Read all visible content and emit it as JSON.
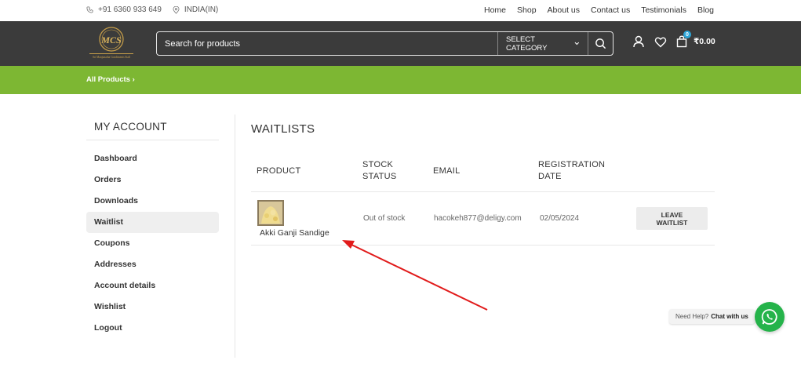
{
  "topbar": {
    "phone": "+91 6360 933 649",
    "location": "INDIA(IN)",
    "nav": [
      "Home",
      "Shop",
      "About us",
      "Contact us",
      "Testimonials",
      "Blog"
    ]
  },
  "header": {
    "logo_text": "MCS",
    "logo_tagline": "Sri Manjunatha Condiments Stall",
    "search_placeholder": "Search for products",
    "category_label": "SELECT CATEGORY",
    "cart_count": "0",
    "cart_total": "₹0.00"
  },
  "breadcrumb": {
    "label": "All Products"
  },
  "sidebar": {
    "title": "MY ACCOUNT",
    "items": [
      {
        "label": "Dashboard",
        "active": false
      },
      {
        "label": "Orders",
        "active": false
      },
      {
        "label": "Downloads",
        "active": false
      },
      {
        "label": "Waitlist",
        "active": true
      },
      {
        "label": "Coupons",
        "active": false
      },
      {
        "label": "Addresses",
        "active": false
      },
      {
        "label": "Account details",
        "active": false
      },
      {
        "label": "Wishlist",
        "active": false
      },
      {
        "label": "Logout",
        "active": false
      }
    ]
  },
  "main": {
    "heading": "WAITLISTS",
    "columns": {
      "product": "PRODUCT",
      "stock_line1": "STOCK",
      "stock_line2": "STATUS",
      "email": "EMAIL",
      "reg_line1": "REGISTRATION",
      "reg_line2": "DATE"
    },
    "rows": [
      {
        "product": "Akki Ganji Sandige",
        "stock": "Out of stock",
        "email": "hacokeh877@deligy.com",
        "date": "02/05/2024",
        "action_line1": "LEAVE",
        "action_line2": "WAITLIST"
      }
    ]
  },
  "help": {
    "prefix": "Need Help?",
    "cta": "Chat with us"
  },
  "colors": {
    "header_bg": "#3b3b3b",
    "green_bar": "#7db733",
    "whatsapp": "#25b34a",
    "annotation_arrow": "#e11b1b"
  }
}
